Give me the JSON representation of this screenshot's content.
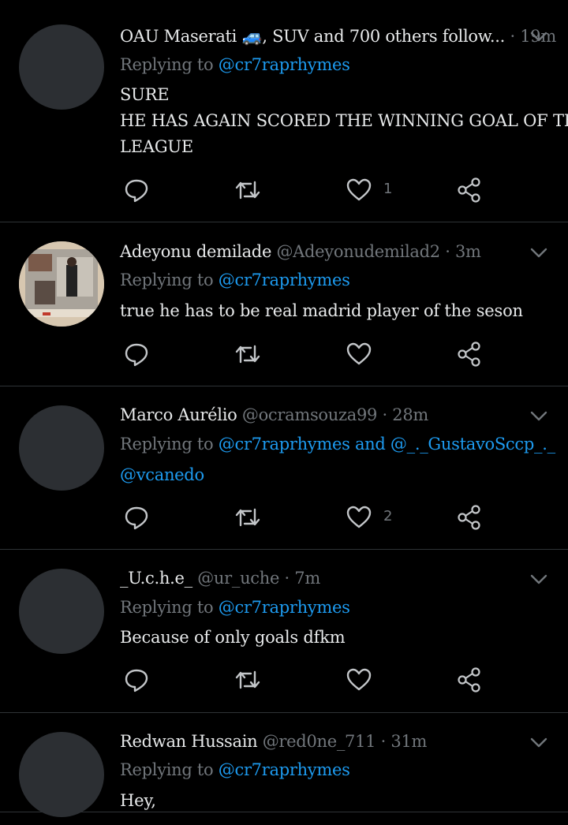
{
  "tweets": [
    {
      "name": "OAU Maserati 🚙, SUV and 700 others follow...",
      "handle": "",
      "time": "19m",
      "replying_prefix": "Replying to ",
      "mentions": "@cr7raprhymes",
      "mentions_line2": "",
      "body": [
        "SURE",
        "HE HAS AGAIN SCORED THE WINNING GOAL OF THE",
        "LEAGUE"
      ],
      "reply_count": "",
      "retweet_count": "",
      "like_count": "1",
      "avatar": "placeholder"
    },
    {
      "name": "Adeyonu demilade",
      "handle": "@Adeyonudemilad2",
      "time": "3m",
      "replying_prefix": "Replying to ",
      "mentions": "@cr7raprhymes",
      "mentions_line2": "",
      "body": [
        "true he has to be real madrid player of the seson"
      ],
      "reply_count": "",
      "retweet_count": "",
      "like_count": "",
      "avatar": "photo"
    },
    {
      "name": "Marco Aurélio",
      "handle": "@ocramsouza99",
      "time": "28m",
      "replying_prefix": "Replying to ",
      "mentions": "@cr7raprhymes and @_._GustavoSccp_._",
      "mentions_line2": "@vcanedo",
      "body": [],
      "reply_count": "",
      "retweet_count": "",
      "like_count": "2",
      "avatar": "placeholder"
    },
    {
      "name": "_U.c.h.e_",
      "handle": "@ur_uche",
      "time": "7m",
      "replying_prefix": "Replying to ",
      "mentions": "@cr7raprhymes",
      "mentions_line2": "",
      "body": [
        "Because of only goals dfkm"
      ],
      "reply_count": "",
      "retweet_count": "",
      "like_count": "",
      "avatar": "placeholder"
    },
    {
      "name": "Redwan Hussain",
      "handle": "@red0ne_711",
      "time": "31m",
      "replying_prefix": "Replying to ",
      "mentions": "@cr7raprhymes",
      "mentions_line2": "",
      "body": [
        "Hey,"
      ],
      "reply_count": "",
      "retweet_count": "",
      "like_count": "",
      "avatar": "placeholder"
    }
  ],
  "separator": "·",
  "icons": [
    "reply-icon",
    "retweet-icon",
    "like-icon",
    "share-icon",
    "chevron-down-icon"
  ],
  "colors": {
    "background": "#000000",
    "text": "#e7e9ea",
    "secondary": "#71767b",
    "link": "#1d9bf0",
    "divider": "#2f3336"
  }
}
